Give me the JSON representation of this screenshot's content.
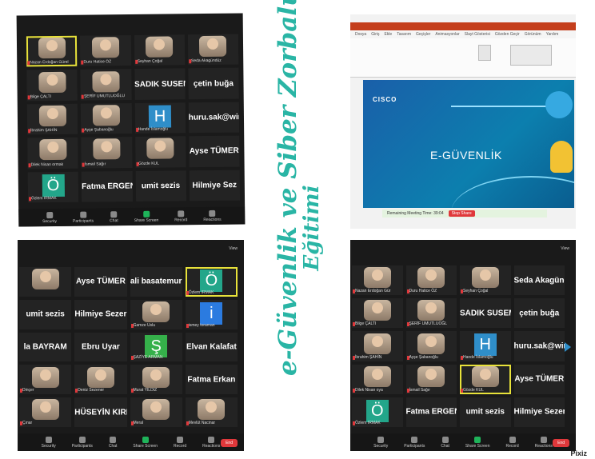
{
  "title_line1": "e-Güvenlik ve Siber Zorbaluk",
  "title_line2": "Eğitimi",
  "watermark": "Pixiz",
  "toolbar": {
    "security": "Security",
    "participants": "Participants",
    "chat": "Chat",
    "share": "Share Screen",
    "record": "Record",
    "reactions": "Reactions",
    "end": "End",
    "view": "View",
    "count": "42"
  },
  "panel_top_left": [
    {
      "cap": "Nazan Erdoğan Gürel",
      "video": true,
      "active": true
    },
    {
      "cap": "Duru Hatice ÖZ",
      "video": true
    },
    {
      "cap": "Seyhan Çoğal",
      "video": true
    },
    {
      "cap": "Seda Akagündüz",
      "video": true
    },
    {
      "cap": "Bilge ÇALTI",
      "video": true
    },
    {
      "cap": "ŞERİF UMUTLUOĞLU",
      "video": true
    },
    {
      "name": "SADIK SUSEM"
    },
    {
      "name": "çetin buğa"
    },
    {
      "cap": "İbrahim ŞAHİN",
      "video": true
    },
    {
      "cap": "Ayşe Şabanoğlu",
      "video": true
    },
    {
      "letter": "H",
      "color": "#2f8ec9",
      "cap": "Hande İslamoğlu"
    },
    {
      "name": "huru.sak@win"
    },
    {
      "cap": "Dilek Nisan ormak",
      "video": true
    },
    {
      "cap": "İsmail Sağır",
      "video": true
    },
    {
      "cap": "Gözde KUL",
      "video": true
    },
    {
      "name": "Ayse TÜMER"
    },
    {
      "letter": "Ö",
      "color": "#23a68a",
      "cap": "Özlem IRMAK"
    },
    {
      "name": "Fatma ERGEN"
    },
    {
      "name": "umit sezis"
    },
    {
      "name": "Hilmiye Sez"
    }
  ],
  "panel_bottom_left": [
    {
      "video": true
    },
    {
      "name": "Ayse TÜMER"
    },
    {
      "name": "ali basatemur"
    },
    {
      "letter": "Ö",
      "color": "#23a68a",
      "cap": "Özlem IRMAK",
      "active": true
    },
    {
      "name": "umit sezis"
    },
    {
      "name": "Hilmiye Sezer"
    },
    {
      "cap": "Gamze Uslu",
      "video": true
    },
    {
      "letter": "i",
      "color": "#2b7be0",
      "cap": "ismey toraman"
    },
    {
      "name": "la BAYRAM"
    },
    {
      "name": "Ebru Uyar"
    },
    {
      "letter": "Ş",
      "color": "#35b04a",
      "cap": "ŞAZİYE ARMAN"
    },
    {
      "name": "Elvan Kalafat"
    },
    {
      "cap": "Dinçer",
      "video": true
    },
    {
      "cap": "Deniz Sezener",
      "video": true
    },
    {
      "cap": "Murat YILDIZ",
      "video": true
    },
    {
      "name": "Fatma Erkan"
    },
    {
      "cap": "Çınar",
      "video": true
    },
    {
      "name": "HÜSEYİN KIRIK"
    },
    {
      "cap": "Meral",
      "video": true
    },
    {
      "cap": "Mevlüt Nacinar",
      "video": true
    }
  ],
  "panel_bottom_right": [
    {
      "cap": "Nazan Erdoğan Gür",
      "video": true
    },
    {
      "cap": "Duru Hatice ÖZ",
      "video": true
    },
    {
      "cap": "Seyhan Çoğal",
      "video": true
    },
    {
      "name": "Seda Akagündüz"
    },
    {
      "cap": "Bilge ÇALTI",
      "video": true
    },
    {
      "cap": "ŞERİF UMUTLUOĞL",
      "video": true
    },
    {
      "name": "SADIK SUSEM"
    },
    {
      "name": "çetin buğa"
    },
    {
      "cap": "İbrahim ŞAHİN",
      "video": true
    },
    {
      "cap": "Ayşe Şabanoğlu",
      "video": true
    },
    {
      "letter": "H",
      "color": "#2f8ec9",
      "cap": "Hande İslamoğlu"
    },
    {
      "name": "huru.sak@win"
    },
    {
      "cap": "Dilek Nisan oya",
      "video": true
    },
    {
      "cap": "İsmail Sağır",
      "video": true
    },
    {
      "cap": "Gözde KUL",
      "video": true,
      "active": true
    },
    {
      "name": "Ayse TÜMER"
    },
    {
      "letter": "Ö",
      "color": "#23a68a",
      "cap": "Özlem IRMAK"
    },
    {
      "name": "Fatma ERGEN"
    },
    {
      "name": "umit sezis"
    },
    {
      "name": "Hilmiye Sezer"
    }
  ],
  "slide": {
    "brand": "CISCO",
    "heading": "E-GÜVENLİK",
    "ribbon_tabs": [
      "Dosya",
      "Giriş",
      "Ekle",
      "Tasarım",
      "Geçişler",
      "Animasyonlar",
      "Slayt Gösterisi",
      "Gözden Geçir",
      "Görünüm",
      "Yardım"
    ],
    "meeting_banner": "Remaining Meeting Time: 39:04",
    "stop_share": "Stop Share"
  },
  "colors": {
    "accent": "#2ab5a5",
    "panel": "#1a1a1a",
    "slide_bg": "#0e5ea5",
    "highlight": "#e8e23a"
  }
}
